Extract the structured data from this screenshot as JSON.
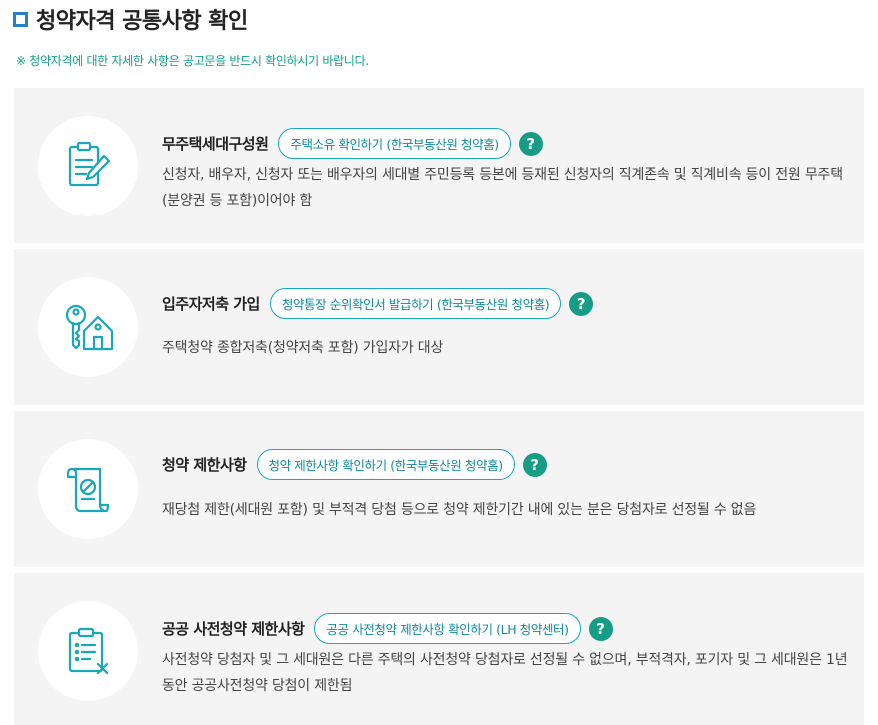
{
  "page": {
    "title": "청약자격 공통사항 확인",
    "notice": "※ 청약자격에 대한 자세한 사항은 공고문을 반드시 확인하시기 바랍니다."
  },
  "cards": [
    {
      "icon": "document-pen-icon",
      "label": "무주택세대구성원",
      "link": "주택소유 확인하기 (한국부동산원 청약홈)",
      "help": "?",
      "desc": "신청자, 배우자, 신청자 또는 배우자의 세대별 주민등록 등본에 등재된 신청자의 직계존속 및 직계비속 등이 전원 무주택(분양권 등 포함)이어야 함"
    },
    {
      "icon": "key-house-icon",
      "label": "입주자저축 가입",
      "link": "청약통장 순위확인서 발급하기 (한국부동산원 청약홈)",
      "help": "?",
      "desc": "주택청약 종합저축(청약저축 포함) 가입자가 대상"
    },
    {
      "icon": "prohibited-scroll-icon",
      "label": "청약 제한사항",
      "link": "청약 제한사항 확인하기 (한국부동산원 청약홈)",
      "help": "?",
      "desc": "재당첨 제한(세대원 포함) 및 부적격 당첨 등으로 청약 제한기간 내에 있는 분은 당첨자로 선정될 수 없음"
    },
    {
      "icon": "clipboard-x-icon",
      "label": "공공 사전청약 제한사항",
      "link": "공공 사전청약 제한사항 확인하기 (LH 청약센터)",
      "help": "?",
      "desc": "사전청약 당첨자 및 그 세대원은 다른 주택의 사전청약 당첨자로 선정될 수 없으며, 부적격자, 포기자 및 그 세대원은 1년 동안 공공사전청약 당첨이 제한됨"
    }
  ],
  "colors": {
    "accent": "#1aa6bb",
    "help": "#179c86",
    "notice": "#13a08d",
    "title_square": "#2a7ec4",
    "card_bg": "#f4f4f4"
  }
}
